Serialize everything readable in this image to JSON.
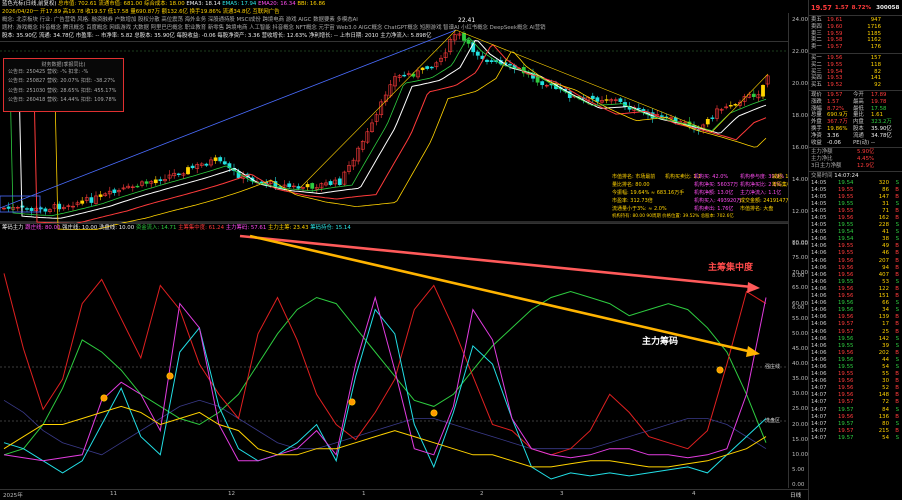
{
  "header": {
    "row1": {
      "stock": "蓝色光标(日线,前复权)",
      "items": [
        {
          "text": "总市值: 702.61",
          "cls": "y"
        },
        {
          "text": "流通市值: 681.00",
          "cls": "y"
        },
        {
          "text": "综合成本: 18.00",
          "cls": "y"
        },
        {
          "text": "EMA3: 18.14",
          "cls": "w"
        },
        {
          "text": "EMA5: 17.94",
          "cls": "c"
        },
        {
          "text": "EMA20: 16.34",
          "cls": "m"
        },
        {
          "text": "BBI: 16.86",
          "cls": "y"
        }
      ]
    },
    "row2": "2026/04/20一 开17.89 高19.78 收19.57 低17.58 量690.87万 额132.6亿 换手19.86% 流通34.8亿 互联网广告",
    "row3": "概念: 北京板块 行业: 广告营销 风格: 融资融券 户数增加 股权分散 高位震荡 海外业务 深股通持股 MSCI成份 跨境电商 游戏 AIGC 数据要素 多模态AI",
    "row4": "题材: 游戏概念 抖音概念 腾讯概念 百度概念 网络游戏 大数据 阿里巴巴概念 职业教育 新零售 跨境电商 人工智能 抖音概念 NFT概念 元宇宙 Web3.0 AIGC概念 ChatGPT概念 短剧游戏 智谱AI 小红书概念 DeepSeek概念 AI营销",
    "row5": "股本: 35.90亿 流通: 34.78亿 市盈率: -- 市净率: 5.82 总股本: 35.90亿 每股收益: -0.06 每股净资产: 3.36 营收增长: 12.63% 净利增长: -- 上市日期: 2010 主力净流入: 5.898亿"
  },
  "fin_panel": {
    "title": "财务数据(季报同比)",
    "rows": [
      "公告日: 250425 营收: -% 扣非: -%",
      "公告日: 250827 营收: 20.07% 扣非: -38.27%",
      "公告日: 251030 营收: 28.65% 扣非: 455.17%",
      "公告日: 260418 营收: 14.44% 扣非: 109.78%"
    ]
  },
  "info_panel": {
    "c1": [
      "市值排名: 市场最前",
      "量比排名: 80.00",
      "今振幅: 19.64% ≈ 683.16万手",
      "市盈率: 312.73倍",
      "流通量小于3%: ≈ 2.0%"
    ],
    "c2": [
      "机构买卖比: 1.1",
      "",
      "",
      "",
      ""
    ],
    "c3": [
      "机构买: 42.0%",
      "机构净买: 56037万",
      "机构净额: 13.0亿",
      "机构买入: 493920万",
      "机构卖出: 1.76亿"
    ],
    "c4": [
      "机构参与度: 39.9%",
      "机构净买比: 2.1%",
      "主力净流入: 1.1亿",
      "成交金额: 2419147万",
      "市值排名: 大盘"
    ],
    "c5": [
      "减超: 12.0%",
      "筹码集中度: ≥3.0%",
      "",
      "",
      ""
    ],
    "extra": "机构持有: 80.00  90周期  价格位置: 39.52%  总股本: 702.6亿"
  },
  "price_axis": [
    "24.00",
    "22.00",
    "20.00",
    "18.00",
    "16.00",
    "14.00",
    "12.00",
    "10.00",
    "8.00",
    "6.00"
  ],
  "price_top": "22.41",
  "indicator_header": {
    "name": "筹码主力",
    "items": [
      {
        "text": "跟庄线: 80.00",
        "cls": "m"
      },
      {
        "text": "强庄线: 10.00",
        "cls": "w"
      },
      {
        "text": "洗盘线: 10.00",
        "cls": "w"
      },
      {
        "text": "资金流入: 14.71",
        "cls": "g"
      },
      {
        "text": "主筹集中度: 61.24",
        "cls": "r"
      },
      {
        "text": "主力筹码: 57.61",
        "cls": "m"
      },
      {
        "text": "主力主筹: 23.43",
        "cls": "y"
      },
      {
        "text": "筹码持仓: 15.14",
        "cls": "c"
      }
    ]
  },
  "ind_axis": [
    "80.00",
    "75.00",
    "70.00",
    "65.00",
    "60.00",
    "55.00",
    "50.00",
    "45.00",
    "40.00",
    "35.00",
    "30.00",
    "25.00",
    "20.00",
    "15.00",
    "10.00",
    "5.00",
    "0.00"
  ],
  "annotations": {
    "red": "主筹集中度",
    "yellow": "主力筹码",
    "red_label_color": "#ff4a4a",
    "white_label_color": "#ffffff"
  },
  "x_axis": [
    "2025年",
    "11",
    "12",
    "1",
    "2",
    "3",
    "4",
    "日线"
  ],
  "ind_tags": {
    "hi": "强庄线",
    "lo": "洗盘区"
  },
  "side": {
    "price": "19.57",
    "change": "1.57",
    "pct": "8.72%",
    "code": "300058",
    "asks": [
      {
        "l": "卖五",
        "p": "19.61",
        "v": "947"
      },
      {
        "l": "卖四",
        "p": "19.60",
        "v": "1716"
      },
      {
        "l": "卖三",
        "p": "19.59",
        "v": "1185"
      },
      {
        "l": "卖二",
        "p": "19.58",
        "v": "1162"
      },
      {
        "l": "卖一",
        "p": "19.57",
        "v": "176"
      }
    ],
    "bids": [
      {
        "l": "买一",
        "p": "19.56",
        "v": "157"
      },
      {
        "l": "买二",
        "p": "19.55",
        "v": "118"
      },
      {
        "l": "买三",
        "p": "19.54",
        "v": "82"
      },
      {
        "l": "买四",
        "p": "19.53",
        "v": "141"
      },
      {
        "l": "买五",
        "p": "19.52",
        "v": "92"
      }
    ],
    "stats": [
      {
        "l": "现价",
        "v": "19.57",
        "cls": "r",
        "l2": "今开",
        "v2": "17.89",
        "cls2": "r"
      },
      {
        "l": "涨跌",
        "v": "1.57",
        "cls": "r",
        "l2": "最高",
        "v2": "19.78",
        "cls2": "r"
      },
      {
        "l": "涨幅",
        "v": "8.72%",
        "cls": "r",
        "l2": "最低",
        "v2": "17.58",
        "cls2": "g"
      },
      {
        "l": "总量",
        "v": "690.9万",
        "cls": "y",
        "l2": "量比",
        "v2": "1.61",
        "cls2": "y"
      },
      {
        "l": "外盘",
        "v": "367.7万",
        "cls": "r",
        "l2": "内盘",
        "v2": "323.2万",
        "cls2": "g"
      },
      {
        "l": "换手",
        "v": "19.86%",
        "cls": "y",
        "l2": "股本",
        "v2": "35.90亿",
        "cls2": "w"
      },
      {
        "l": "净资",
        "v": "3.36",
        "cls": "w",
        "l2": "流通",
        "v2": "34.78亿",
        "cls2": "w"
      },
      {
        "l": "收益",
        "v": "-0.06",
        "cls": "w",
        "l2": "PE(动)",
        "v2": "--",
        "cls2": "w"
      }
    ],
    "flow": [
      {
        "l": "主力净额",
        "v": "5.90亿",
        "cls": "r"
      },
      {
        "l": "主力净比",
        "v": "4.45%",
        "cls": "r"
      },
      {
        "l": "3日主力净额",
        "v": "12.9亿",
        "cls": "r"
      }
    ],
    "trade_label": "交易时间",
    "trade_time": "14:07:24",
    "ticks": [
      {
        "t": "14:05",
        "p": "19.54",
        "v": "320",
        "d": "S"
      },
      {
        "t": "14:05",
        "p": "19.55",
        "v": "86",
        "d": "B"
      },
      {
        "t": "14:05",
        "p": "19.55",
        "v": "147",
        "d": "B"
      },
      {
        "t": "14:05",
        "p": "19.55",
        "v": "31",
        "d": "S"
      },
      {
        "t": "14:05",
        "p": "19.55",
        "v": "71",
        "d": "B"
      },
      {
        "t": "14:05",
        "p": "19.56",
        "v": "162",
        "d": "B"
      },
      {
        "t": "14:05",
        "p": "19.55",
        "v": "228",
        "d": "S"
      },
      {
        "t": "14:05",
        "p": "19.54",
        "v": "41",
        "d": "S"
      },
      {
        "t": "14:06",
        "p": "19.54",
        "v": "38",
        "d": "S"
      },
      {
        "t": "14:06",
        "p": "19.55",
        "v": "49",
        "d": "B"
      },
      {
        "t": "14:06",
        "p": "19.55",
        "v": "46",
        "d": "B"
      },
      {
        "t": "14:06",
        "p": "19.56",
        "v": "207",
        "d": "B"
      },
      {
        "t": "14:06",
        "p": "19.56",
        "v": "94",
        "d": "B"
      },
      {
        "t": "14:06",
        "p": "19.56",
        "v": "407",
        "d": "B"
      },
      {
        "t": "14:06",
        "p": "19.55",
        "v": "53",
        "d": "S"
      },
      {
        "t": "14:06",
        "p": "19.56",
        "v": "122",
        "d": "B"
      },
      {
        "t": "14:06",
        "p": "19.56",
        "v": "151",
        "d": "B"
      },
      {
        "t": "14:06",
        "p": "19.56",
        "v": "66",
        "d": "S"
      },
      {
        "t": "14:06",
        "p": "19.56",
        "v": "34",
        "d": "S"
      },
      {
        "t": "14:06",
        "p": "19.56",
        "v": "139",
        "d": "B"
      },
      {
        "t": "14:06",
        "p": "19.57",
        "v": "17",
        "d": "B"
      },
      {
        "t": "14:06",
        "p": "19.57",
        "v": "25",
        "d": "B"
      },
      {
        "t": "14:06",
        "p": "19.56",
        "v": "142",
        "d": "S"
      },
      {
        "t": "14:06",
        "p": "19.55",
        "v": "39",
        "d": "S"
      },
      {
        "t": "14:06",
        "p": "19.56",
        "v": "202",
        "d": "B"
      },
      {
        "t": "14:06",
        "p": "19.56",
        "v": "44",
        "d": "S"
      },
      {
        "t": "14:06",
        "p": "19.55",
        "v": "54",
        "d": "S"
      },
      {
        "t": "14:06",
        "p": "19.55",
        "v": "55",
        "d": "B"
      },
      {
        "t": "14:06",
        "p": "19.56",
        "v": "30",
        "d": "B"
      },
      {
        "t": "14:07",
        "p": "19.56",
        "v": "52",
        "d": "B"
      },
      {
        "t": "14:07",
        "p": "19.56",
        "v": "148",
        "d": "B"
      },
      {
        "t": "14:07",
        "p": "19.57",
        "v": "72",
        "d": "B"
      },
      {
        "t": "14:07",
        "p": "19.57",
        "v": "84",
        "d": "S"
      },
      {
        "t": "14:07",
        "p": "19.56",
        "v": "136",
        "d": "B"
      },
      {
        "t": "14:07",
        "p": "19.57",
        "v": "80",
        "d": "S"
      },
      {
        "t": "14:07",
        "p": "19.57",
        "v": "215",
        "d": "B"
      },
      {
        "t": "14:07",
        "p": "19.57",
        "v": "54",
        "d": "S"
      }
    ]
  }
}
